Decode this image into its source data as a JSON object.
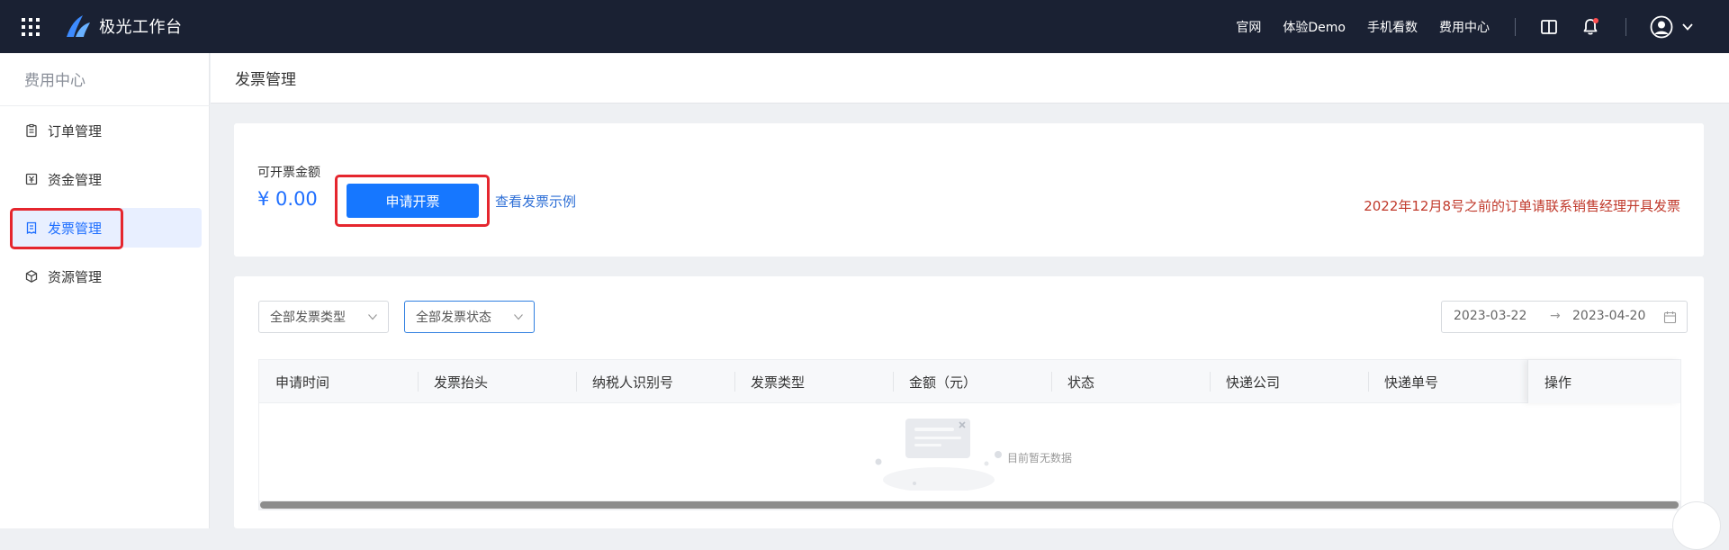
{
  "header": {
    "brand": "极光工作台",
    "nav": [
      "官网",
      "体验Demo",
      "手机看数",
      "费用中心"
    ],
    "icons": [
      "apps-grid-icon",
      "logo-icon",
      "book-icon",
      "bell-icon",
      "user-avatar-icon",
      "chevron-down-icon"
    ]
  },
  "sidebar": {
    "title": "费用中心",
    "items": [
      {
        "label": "订单管理",
        "icon": "clipboard-icon"
      },
      {
        "label": "资金管理",
        "icon": "yuan-icon"
      },
      {
        "label": "发票管理",
        "icon": "receipt-icon",
        "active": true
      },
      {
        "label": "资源管理",
        "icon": "cube-icon"
      }
    ]
  },
  "page": {
    "title": "发票管理"
  },
  "summary": {
    "amount_label": "可开票金额",
    "amount_value": "¥ 0.00",
    "apply_button": "申请开票",
    "example_link": "查看发票示例",
    "notice": "2022年12月8号之前的订单请联系销售经理开具发票"
  },
  "filters": {
    "invoice_type": "全部发票类型",
    "invoice_status": "全部发票状态",
    "date_start": "2023-03-22",
    "date_sep": "→",
    "date_end": "2023-04-20"
  },
  "table": {
    "columns": [
      "申请时间",
      "发票抬头",
      "纳税人识别号",
      "发票类型",
      "金额（元）",
      "状态",
      "快递公司",
      "快递单号",
      "操作"
    ],
    "empty_text": "目前暂无数据"
  },
  "colors": {
    "topbar": "#1a2133",
    "primary": "#1677ff",
    "notice": "#c0392b",
    "highlight": "#e5262e"
  }
}
